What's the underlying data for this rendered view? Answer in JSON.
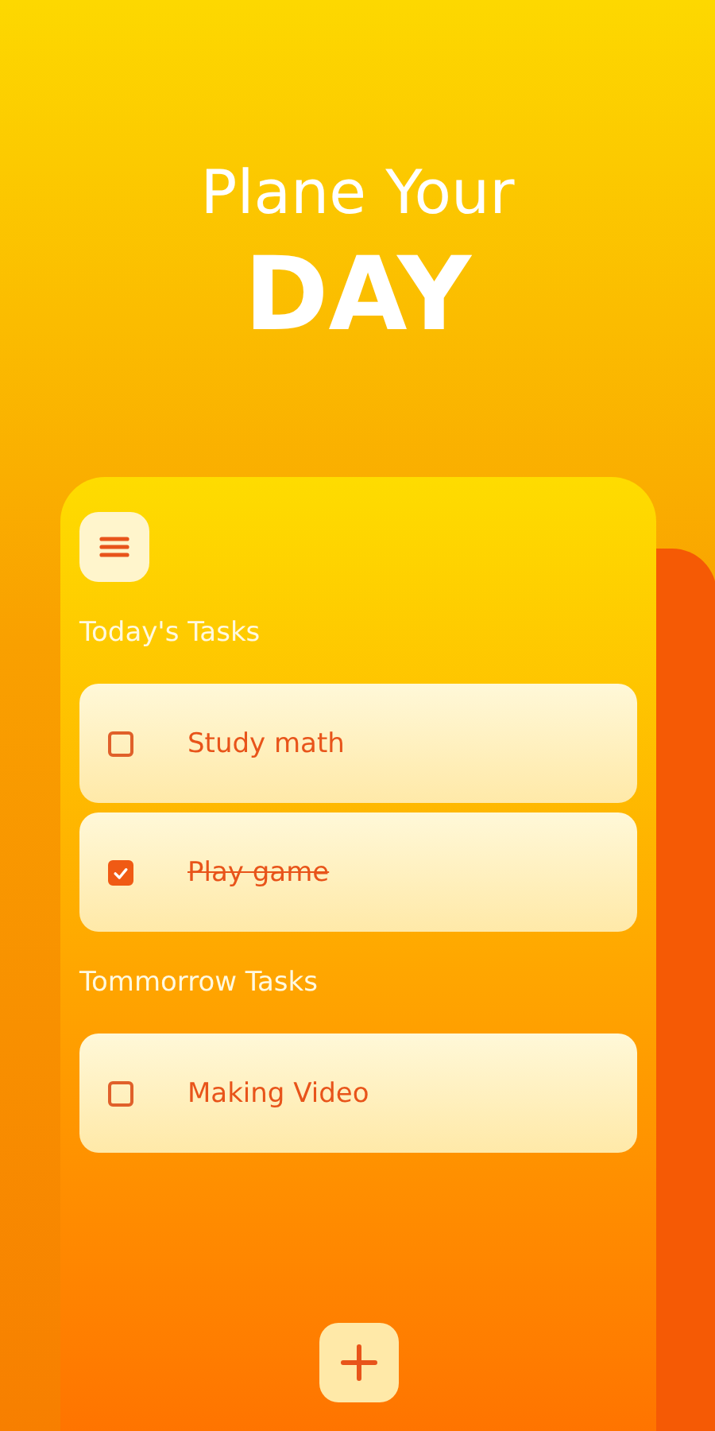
{
  "headline": {
    "line_1": "Plane Your",
    "line_2": "DAY"
  },
  "sections": [
    {
      "title": "Today's Tasks",
      "tasks": [
        {
          "label": "Study math",
          "checked": false
        },
        {
          "label": "Play game",
          "checked": true
        }
      ]
    },
    {
      "title": "Tommorrow Tasks",
      "tasks": [
        {
          "label": "Making Video",
          "checked": false
        }
      ]
    }
  ]
}
